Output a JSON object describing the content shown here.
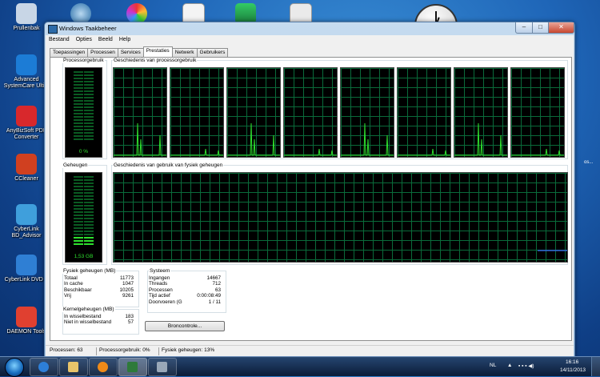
{
  "desktop": {
    "icons": [
      {
        "label": "Prullenbak",
        "color": "#c8d6e6"
      },
      {
        "label": "Advanced SystemCare Ultim",
        "color": "#1c7cd6"
      },
      {
        "label": "AnyBizSoft PDF Converter",
        "color": "#d8282c"
      },
      {
        "label": "CCleaner",
        "color": "#d04020"
      },
      {
        "label": "CyberLink BD_Advisor",
        "color": "#3f9fdc"
      },
      {
        "label": "CyberLink DVD S",
        "color": "#2f7fd4"
      },
      {
        "label": "DAEMON Tools",
        "color": "#e04030"
      }
    ],
    "right_edge_text": "os..."
  },
  "window": {
    "title": "Windows Taakbeheer",
    "controls": {
      "minimize": "–",
      "maximize": "□",
      "close": "✕"
    },
    "menu": [
      "Bestand",
      "Opties",
      "Beeld",
      "Help"
    ],
    "tabs": [
      "Toepassingen",
      "Processen",
      "Services",
      "Prestaties",
      "Netwerk",
      "Gebruikers"
    ],
    "active_tab": "Prestaties",
    "cpu": {
      "meter_label": "Processorgebruik",
      "meter_value": "0 %",
      "meter_fraction": 0.0,
      "history_label": "Geschiedenis van processorgebruik",
      "core_count": 8
    },
    "memory": {
      "meter_label": "Geheugen",
      "meter_value": "1,53 GB",
      "meter_fraction": 0.13,
      "history_label": "Geschiedenis van gebruik van fysiek geheugen"
    },
    "physical_memory": {
      "title": "Fysiek geheugen (MB)",
      "rows": [
        {
          "k": "Totaal",
          "v": "11773"
        },
        {
          "k": "In cache",
          "v": "1047"
        },
        {
          "k": "Beschikbaar",
          "v": "10205"
        },
        {
          "k": "Vrij",
          "v": "9261"
        }
      ]
    },
    "kernel_memory": {
      "title": "Kernelgeheugen (MB)",
      "rows": [
        {
          "k": "In wisselbestand",
          "v": "183"
        },
        {
          "k": "Niet in wisselbestand",
          "v": "57"
        }
      ]
    },
    "system": {
      "title": "Systeem",
      "rows": [
        {
          "k": "Ingangen",
          "v": "14667"
        },
        {
          "k": "Threads",
          "v": "712"
        },
        {
          "k": "Processen",
          "v": "63"
        },
        {
          "k": "Tijd actief",
          "v": "0:00:08:49"
        },
        {
          "k": "Doorvoeren (G",
          "v": "1 / 11"
        }
      ]
    },
    "resource_button": "Broncontrole...",
    "status": {
      "processes": "Processen: 63",
      "cpu": "Processorgebruik: 0%",
      "memory": "Fysiek geheugen: 13%"
    }
  },
  "taskbar": {
    "language": "NL",
    "time": "16:16",
    "date": "14/11/2013"
  },
  "colors": {
    "graph_line": "#2ee02e",
    "grid": "#0a6b3a",
    "mem_line": "#3b6bff"
  }
}
